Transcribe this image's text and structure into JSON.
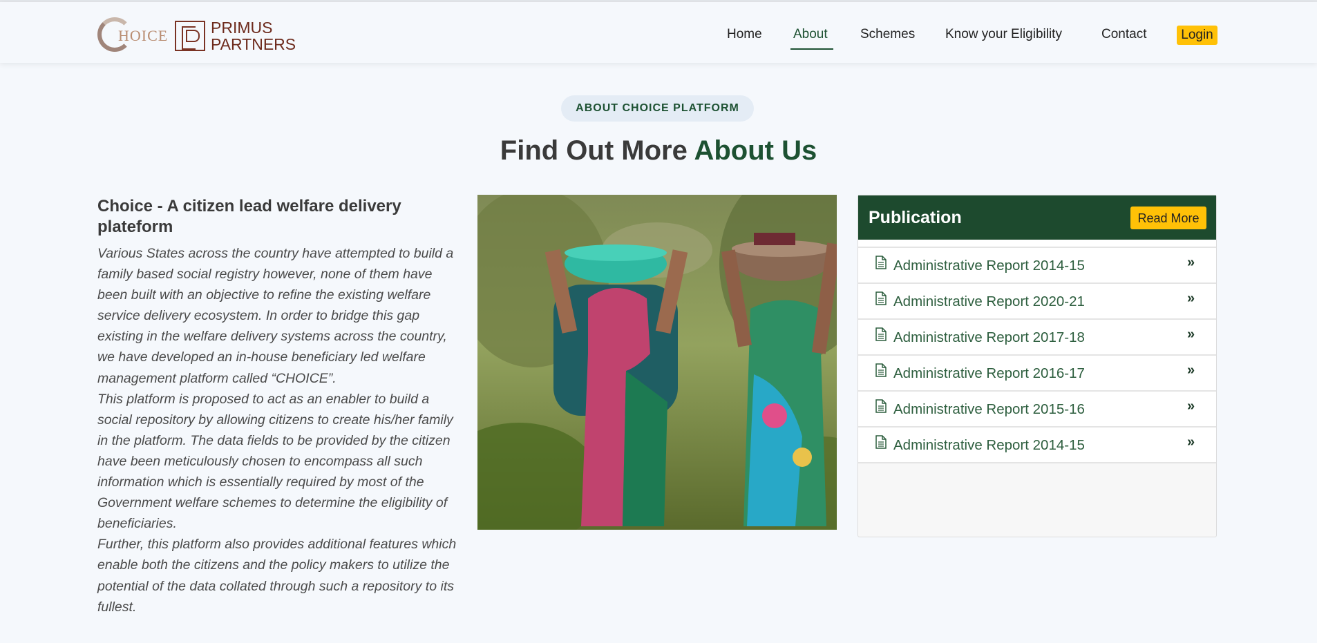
{
  "header": {
    "choice_logo_text": "HOICE",
    "primus_logo_line1": "PRIMUS",
    "primus_logo_line2": "PARTNERS"
  },
  "nav": {
    "items": [
      {
        "label": "Home",
        "active": false
      },
      {
        "label": "About",
        "active": true
      },
      {
        "label": "Schemes",
        "active": false
      },
      {
        "label": "Know your Eligibility",
        "active": false
      },
      {
        "label": "Contact",
        "active": false
      }
    ],
    "login_label": "Login"
  },
  "section": {
    "pill_label": "ABOUT CHOICE PLATFORM",
    "heading_plain": "Find Out More ",
    "heading_accent": "About Us"
  },
  "about": {
    "title": "Choice - A citizen lead welfare delivery plateform",
    "paragraphs": [
      "Various States across the country have attempted to build a family based social registry however, none of them have been built with an objective to refine the existing welfare service delivery ecosystem. In order to bridge this gap existing in the welfare delivery systems across the country, we have developed an in-house beneficiary led welfare management platform called “CHOICE”.",
      "This platform is proposed to act as an enabler to build a social repository by allowing citizens to create his/her family in the platform. The data fields to be provided by the citizen have been meticulously chosen to encompass all such information which is essentially required by most of the Government welfare schemes to determine the eligibility of beneficiaries.",
      "Further, this platform also provides additional features which enable both the citizens and the policy makers to utilize the potential of the data collated through such a repository to its fullest."
    ]
  },
  "publication": {
    "title": "Publication",
    "read_more_label": "Read More",
    "items": [
      "Administrative Report 2014-15",
      "Administrative Report 2020-21",
      "Administrative Report 2017-18",
      "Administrative Report 2016-17",
      "Administrative Report 2015-16",
      "Administrative Report 2014-15"
    ],
    "chevron": "»"
  },
  "colors": {
    "brand_green": "#1d5132",
    "accent_yellow": "#ffc107",
    "background": "#f5f8fc"
  }
}
